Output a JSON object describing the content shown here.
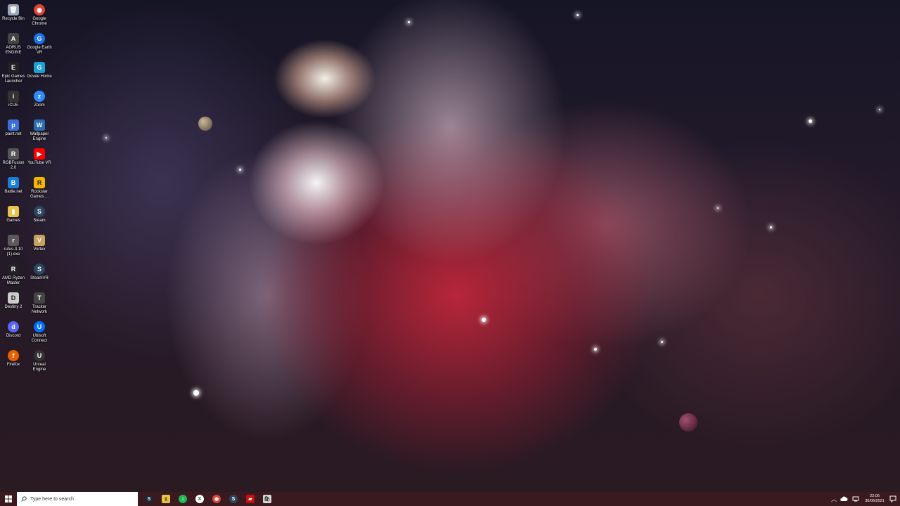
{
  "desktop": {
    "icons_col1": [
      {
        "label": "Recycle Bin",
        "icon": "recycle-bin-icon",
        "color": "#9aa7b8",
        "glyph": "🗑"
      },
      {
        "label": "AORUS ENGINE",
        "icon": "aorus-engine-icon",
        "color": "#444444",
        "glyph": "A"
      },
      {
        "label": "Epic Games Launcher",
        "icon": "epic-games-icon",
        "color": "#222222",
        "glyph": "E"
      },
      {
        "label": "iCUE",
        "icon": "icue-icon",
        "color": "#333333",
        "glyph": "i"
      },
      {
        "label": "paint.net",
        "icon": "paintnet-icon",
        "color": "#3a6fd8",
        "glyph": "p"
      },
      {
        "label": "RGBFusion 2.0",
        "icon": "rgbfusion-icon",
        "color": "#555555",
        "glyph": "R"
      },
      {
        "label": "Battle.net",
        "icon": "battlenet-icon",
        "color": "#1a7dd8",
        "glyph": "B"
      },
      {
        "label": "Games",
        "icon": "folder-icon",
        "color": "#e8c24a",
        "glyph": "▮"
      },
      {
        "label": "rufus-3.10 (1).exe",
        "icon": "rufus-icon",
        "color": "#5a5a5a",
        "glyph": "r"
      },
      {
        "label": "AMD Ryzen Master",
        "icon": "amd-ryzen-icon",
        "color": "#222222",
        "glyph": "R"
      },
      {
        "label": "Destiny 2",
        "icon": "destiny-icon",
        "color": "#cccccc",
        "glyph": "D"
      },
      {
        "label": "Discord",
        "icon": "discord-icon",
        "color": "#5865f2",
        "glyph": "d"
      },
      {
        "label": "Firefox",
        "icon": "firefox-icon",
        "color": "#e66000",
        "glyph": "f"
      }
    ],
    "icons_col2": [
      {
        "label": "Google Chrome",
        "icon": "chrome-icon",
        "color": "#db4437",
        "glyph": "◉"
      },
      {
        "label": "Google Earth VR",
        "icon": "google-earth-vr-icon",
        "color": "#1a73e8",
        "glyph": "G"
      },
      {
        "label": "Govee Home",
        "icon": "govee-icon",
        "color": "#1aa0d8",
        "glyph": "G"
      },
      {
        "label": "Zoom",
        "icon": "zoom-icon",
        "color": "#2d8cff",
        "glyph": "z"
      },
      {
        "label": "Wallpaper Engine",
        "icon": "wallpaper-engine-icon",
        "color": "#2a6db0",
        "glyph": "W"
      },
      {
        "label": "YouTube VR",
        "icon": "youtube-vr-icon",
        "color": "#ff0000",
        "glyph": "▶"
      },
      {
        "label": "Rockstar Games ...",
        "icon": "rockstar-icon",
        "color": "#f5b800",
        "glyph": "R"
      },
      {
        "label": "Steam",
        "icon": "steam-icon",
        "color": "#2a475e",
        "glyph": "S"
      },
      {
        "label": "Vortex",
        "icon": "vortex-icon",
        "color": "#c8a060",
        "glyph": "V"
      },
      {
        "label": "SteamVR",
        "icon": "steamvr-icon",
        "color": "#2a475e",
        "glyph": "S"
      },
      {
        "label": "Tracker Network",
        "icon": "tracker-network-icon",
        "color": "#444444",
        "glyph": "T"
      },
      {
        "label": "Ubisoft Connect",
        "icon": "ubisoft-icon",
        "color": "#0070ff",
        "glyph": "U"
      },
      {
        "label": "Unreal Engine",
        "icon": "unreal-engine-icon",
        "color": "#333333",
        "glyph": "U"
      }
    ]
  },
  "taskbar": {
    "search_placeholder": "Type here to search",
    "pinned": [
      {
        "name": "steam",
        "icon": "steam-icon",
        "color": "#1b2838",
        "glyph": "S"
      },
      {
        "name": "file-explorer",
        "icon": "folder-icon",
        "color": "#e8c24a",
        "glyph": "▮"
      },
      {
        "name": "spotify",
        "icon": "spotify-icon",
        "color": "#1db954",
        "glyph": "♫"
      },
      {
        "name": "xbox",
        "icon": "xbox-icon",
        "color": "#107c10",
        "glyph": "X"
      },
      {
        "name": "chrome",
        "icon": "chrome-icon",
        "color": "#db4437",
        "glyph": "◉"
      },
      {
        "name": "steam-2",
        "icon": "steam-icon",
        "color": "#2a475e",
        "glyph": "S"
      },
      {
        "name": "app-red",
        "icon": "red-app-icon",
        "color": "#c81010",
        "glyph": "▰"
      },
      {
        "name": "store",
        "icon": "store-icon",
        "color": "#d8d8d8",
        "glyph": "🛍"
      }
    ],
    "clock_time": "22:06",
    "clock_date": "30/06/2021"
  },
  "colors": {
    "taskbar_bg": "#3a1a1e",
    "search_bg": "#ffffff"
  }
}
